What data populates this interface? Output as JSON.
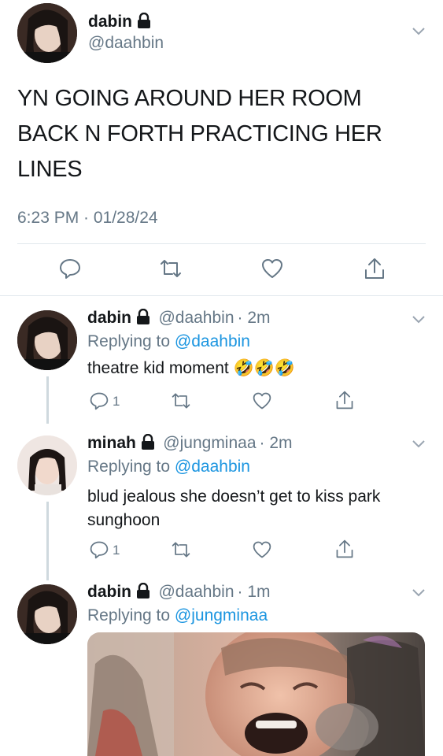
{
  "main_tweet": {
    "name": "dabin",
    "handle": "@daahbin",
    "text_lines": [
      "YN GOING AROUND HER ROOM",
      "BACK N FORTH PRACTICING HER",
      "LINES"
    ],
    "timestamp": "6:23 PM · 01/28/24"
  },
  "replies": [
    {
      "name": "dabin",
      "handle": "@daahbin",
      "time": "· 2m",
      "replying_prefix": "Replying to ",
      "replying_to": "@daahbin",
      "text": "theatre kid moment 🤣🤣🤣",
      "reply_count": "1"
    },
    {
      "name": "minah",
      "handle": "@jungminaa",
      "time": "· 2m",
      "replying_prefix": "Replying to ",
      "replying_to": "@daahbin",
      "text_lines": [
        "blud jealous she doesn’t get to kiss park",
        "sunghoon"
      ],
      "reply_count": "1"
    },
    {
      "name": "dabin",
      "handle": "@daahbin",
      "time": "· 1m",
      "replying_prefix": "Replying to ",
      "replying_to": "@jungminaa"
    }
  ],
  "colors": {
    "link": "#1b95e0",
    "secondary": "#657786",
    "divider": "#e1e8ed",
    "thread_line": "#cfd9de"
  },
  "icons": [
    "lock-icon",
    "chevron-down-icon",
    "reply-icon",
    "retweet-icon",
    "like-icon",
    "share-icon"
  ]
}
